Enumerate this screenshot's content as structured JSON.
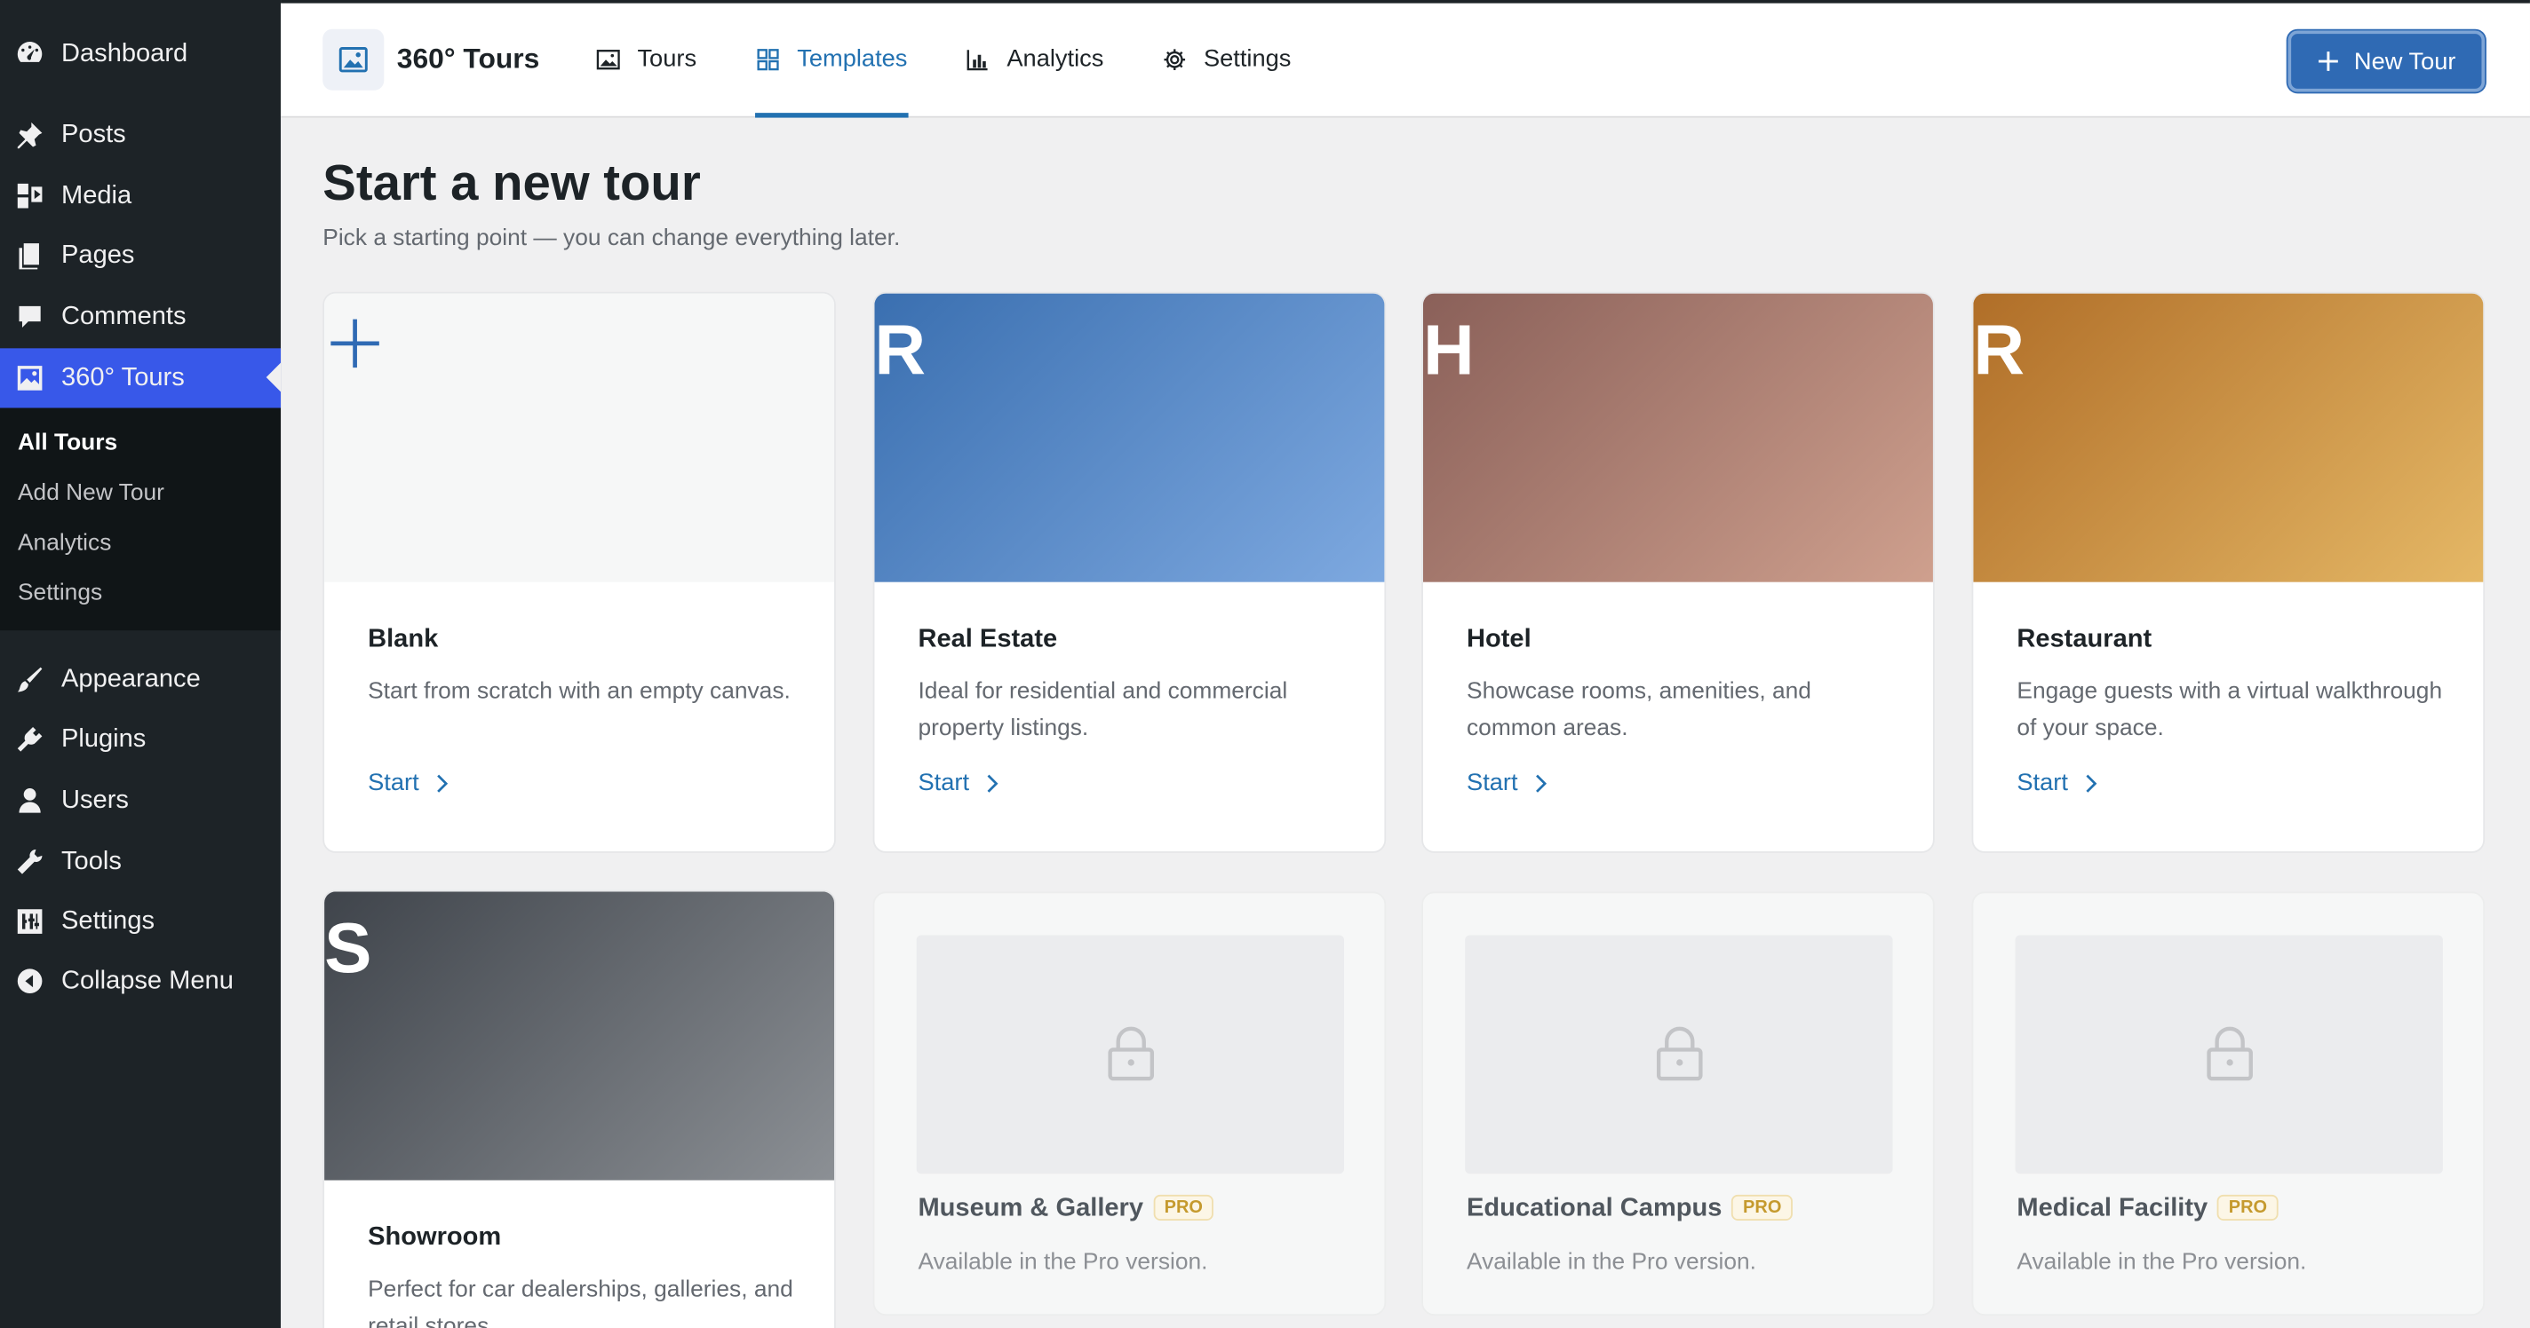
{
  "sidebar": {
    "items": [
      {
        "label": "Dashboard",
        "icon": "dashboard-icon"
      },
      {
        "label": "Posts",
        "icon": "pin-icon"
      },
      {
        "label": "Media",
        "icon": "media-icon"
      },
      {
        "label": "Pages",
        "icon": "pages-icon"
      },
      {
        "label": "Comments",
        "icon": "comment-icon"
      },
      {
        "label": "360° Tours",
        "icon": "image-icon"
      },
      {
        "label": "Appearance",
        "icon": "brush-icon"
      },
      {
        "label": "Plugins",
        "icon": "plug-icon"
      },
      {
        "label": "Users",
        "icon": "user-icon"
      },
      {
        "label": "Tools",
        "icon": "wrench-icon"
      },
      {
        "label": "Settings",
        "icon": "sliders-icon"
      },
      {
        "label": "Collapse Menu",
        "icon": "collapse-icon"
      }
    ],
    "submenu": [
      "All Tours",
      "Add New Tour",
      "Analytics",
      "Settings"
    ]
  },
  "header": {
    "brand": "360° Tours",
    "tabs": [
      {
        "label": "Tours"
      },
      {
        "label": "Templates"
      },
      {
        "label": "Analytics"
      },
      {
        "label": "Settings"
      }
    ],
    "new_button": "New Tour"
  },
  "main": {
    "title": "Start a new tour",
    "subtitle": "Pick a starting point — you can change everything later.",
    "start_label": "Start",
    "templates": [
      {
        "name": "Blank",
        "desc": "Start from scratch with an empty canvas.",
        "letter": "+",
        "colors": [
          "#f6f7f7",
          "#f6f7f7"
        ]
      },
      {
        "name": "Real Estate",
        "desc": "Ideal for residential and commercial property listings.",
        "letter": "R",
        "colors": [
          "#3a6fb0",
          "#7ea9e0"
        ]
      },
      {
        "name": "Hotel",
        "desc": "Showcase rooms, amenities, and common areas.",
        "letter": "H",
        "colors": [
          "#8a6059",
          "#cfa08e"
        ]
      },
      {
        "name": "Restaurant",
        "desc": "Engage guests with a virtual walkthrough of your space.",
        "letter": "R",
        "colors": [
          "#b06e28",
          "#e5b866"
        ]
      },
      {
        "name": "Showroom",
        "desc": "Perfect for car dealerships, galleries, and retail stores.",
        "letter": "S",
        "colors": [
          "#3f444b",
          "#8c9095"
        ]
      }
    ],
    "pro_templates": [
      {
        "name": "Museum & Gallery",
        "note": "Available in the Pro version."
      },
      {
        "name": "Educational Campus",
        "note": "Available in the Pro version."
      },
      {
        "name": "Medical Facility",
        "note": "Available in the Pro version."
      }
    ],
    "pro_badge": "PRO"
  },
  "colors": {
    "accent": "#2271b1",
    "sidebar": "#1d2327",
    "active_menu": "#3858e9"
  }
}
